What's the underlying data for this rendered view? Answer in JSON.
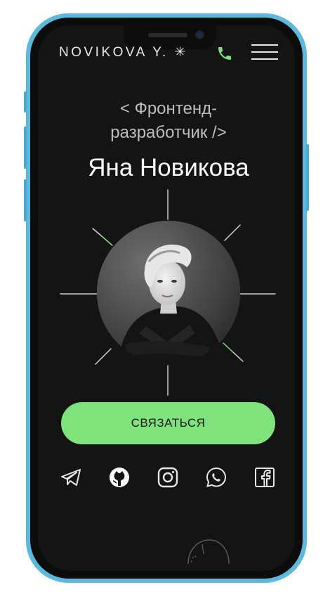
{
  "header": {
    "logo": "NOVIKOVA Y. ✳",
    "phone_icon": "phone-icon",
    "menu_icon": "hamburger-menu-icon"
  },
  "hero": {
    "role_line1": "< Фронтенд-",
    "role_line2": "разработчик />",
    "name": "Яна Новикова"
  },
  "cta": {
    "label": "СВЯЗАТЬСЯ"
  },
  "social_icons": [
    "telegram-icon",
    "github-icon",
    "instagram-icon",
    "whatsapp-icon",
    "facebook-icon"
  ],
  "colors": {
    "background": "#141414",
    "accent": "#7ee37a",
    "text": "#ffffff",
    "muted": "#bcbcbc",
    "frame": "#5cb8dc"
  }
}
